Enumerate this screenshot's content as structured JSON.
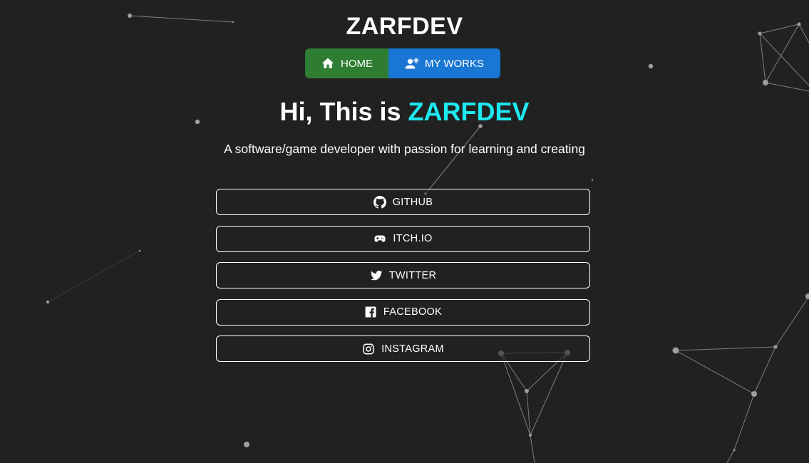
{
  "brand": {
    "title": "ZARFDEV"
  },
  "nav": {
    "home_label": "HOME",
    "home_icon": "home-icon",
    "home_color": "#2e7d32",
    "works_label": "MY WORKS",
    "works_icon": "engineer-icon",
    "works_color": "#1976d2"
  },
  "hero": {
    "greeting": "Hi, This is ",
    "name": "ZARFDEV",
    "accent_color": "#1de9f0",
    "tagline": "A software/game developer with passion for learning and creating"
  },
  "links": [
    {
      "label": "GITHUB",
      "icon": "github-icon"
    },
    {
      "label": "ITCH.IO",
      "icon": "gamepad-icon"
    },
    {
      "label": "TWITTER",
      "icon": "twitter-icon"
    },
    {
      "label": "FACEBOOK",
      "icon": "facebook-icon"
    },
    {
      "label": "INSTAGRAM",
      "icon": "instagram-icon"
    }
  ],
  "theme": {
    "background": "#212121",
    "text": "#ffffff"
  }
}
